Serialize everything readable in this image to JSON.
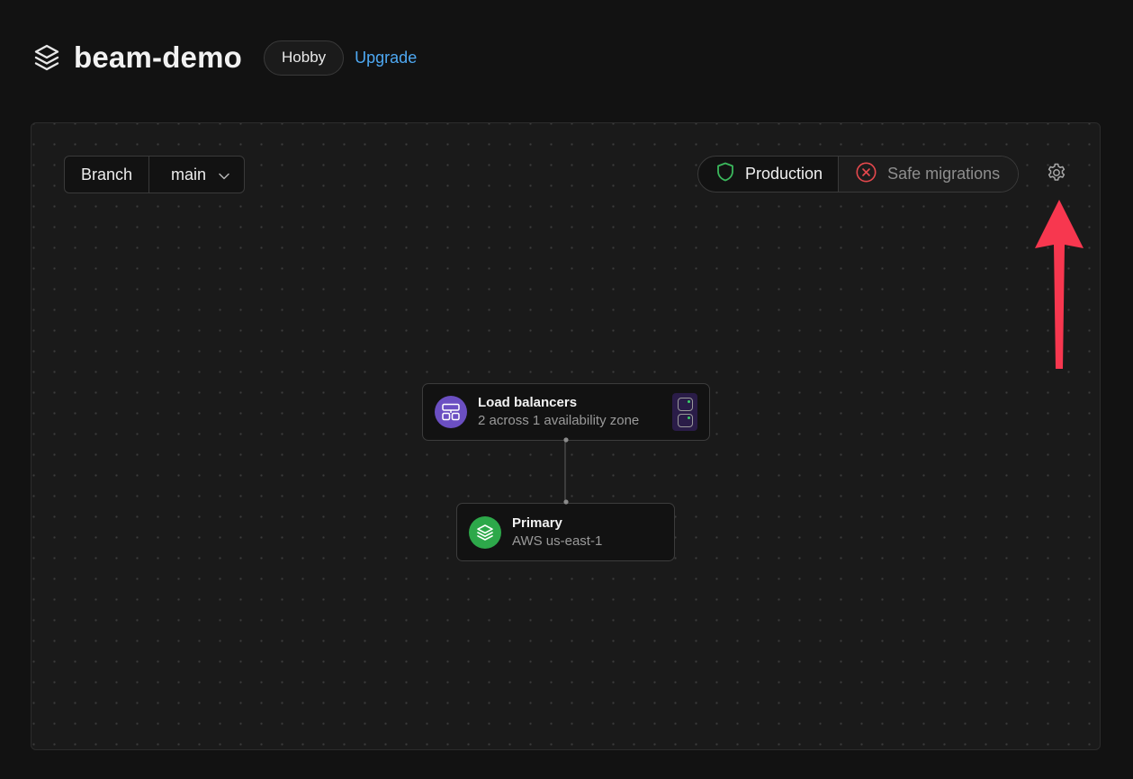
{
  "header": {
    "db_name": "beam-demo",
    "plan_badge": "Hobby",
    "upgrade_label": "Upgrade",
    "logo_icon": "stacked-layers-icon"
  },
  "toolbar": {
    "branch_label": "Branch",
    "branch_value": "main",
    "production_label": "Production",
    "safe_migrations_label": "Safe migrations",
    "production_icon": "shield-icon",
    "safe_migrations_icon": "x-circle-icon",
    "settings_icon": "gear-icon"
  },
  "diagram": {
    "load_balancers": {
      "title": "Load balancers",
      "subtitle": "2 across 1 availability zone",
      "icon": "load-balancer-icon"
    },
    "primary": {
      "title": "Primary",
      "subtitle": "AWS us-east-1",
      "icon": "database-layers-icon"
    }
  },
  "colors": {
    "accent_link": "#4ea8f2",
    "production_shield": "#3bb85c",
    "safe_migrations_x": "#e5484d",
    "lb_icon_bg": "#6b4fc2",
    "primary_icon_bg": "#2da84a",
    "annotation_arrow": "#f7374f"
  }
}
